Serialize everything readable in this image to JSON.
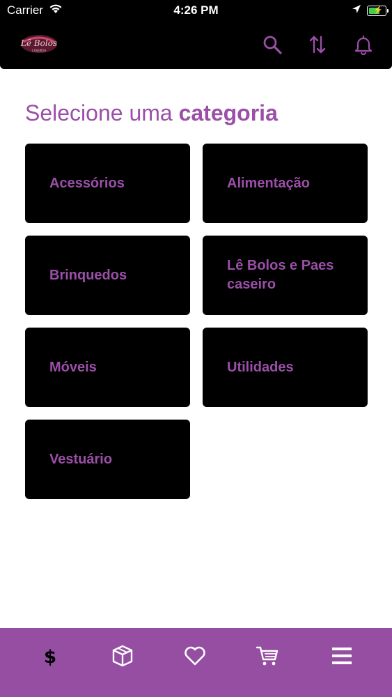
{
  "status_bar": {
    "carrier": "Carrier",
    "time": "4:26 PM",
    "icons": [
      "wifi-icon",
      "location-arrow-icon",
      "battery-charging-icon"
    ]
  },
  "header": {
    "logo_text": "Lê Bolos",
    "logo_subtext": "CASEIROS",
    "icons": [
      "search-icon",
      "sort-icon",
      "bell-icon"
    ]
  },
  "main": {
    "title_regular": "Selecione uma",
    "title_bold": "categoria",
    "categories": [
      {
        "label": "Acessórios"
      },
      {
        "label": "Alimentação"
      },
      {
        "label": "Brinquedos"
      },
      {
        "label": "Lê  Bolos e Paes\ncaseiro"
      },
      {
        "label": "Móveis"
      },
      {
        "label": "Utilidades"
      },
      {
        "label": "Vestuário"
      }
    ]
  },
  "tab_bar": {
    "tabs": [
      {
        "icon": "dollar-icon"
      },
      {
        "icon": "box-icon"
      },
      {
        "icon": "heart-icon"
      },
      {
        "icon": "cart-icon"
      },
      {
        "icon": "menu-icon"
      }
    ]
  },
  "colors": {
    "accent": "#9b4fa8",
    "tab_bar_bg": "#964ea3",
    "header_bg": "#000000",
    "card_bg": "#000000"
  }
}
